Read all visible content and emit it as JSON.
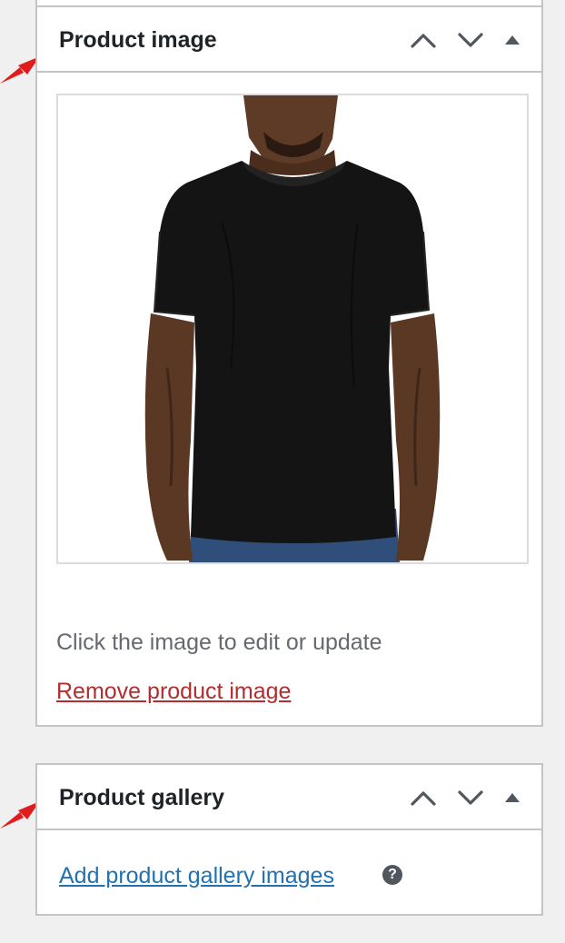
{
  "product_image": {
    "title": "Product image",
    "image_icon": "black-tshirt-model-photo",
    "help_text": "Click the image to edit or update",
    "remove_link": "Remove product image"
  },
  "product_gallery": {
    "title": "Product gallery",
    "add_link": "Add product gallery images",
    "help_tip_icon": "?"
  },
  "header_controls": {
    "move_up_icon": "chevron-up-icon",
    "move_down_icon": "chevron-down-icon",
    "toggle_icon": "triangle-up-icon"
  },
  "colors": {
    "background": "#f0f0f1",
    "panel": "#ffffff",
    "border": "#c3c4c7",
    "title_text": "#1d2327",
    "muted_text": "#646970",
    "remove_link": "#b32d2e",
    "add_link": "#2271b1",
    "arrow": "#e21b1b"
  }
}
